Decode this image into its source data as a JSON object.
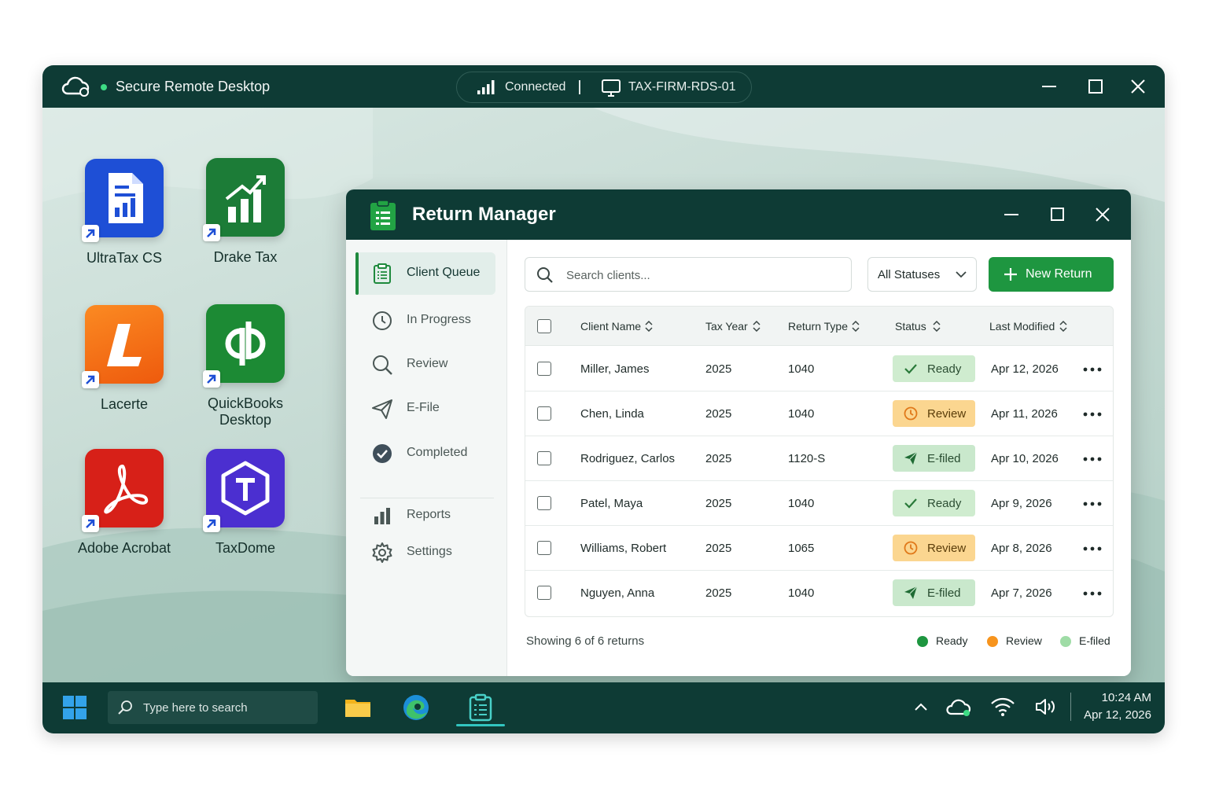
{
  "remote_desktop": {
    "title": "Secure Remote Desktop",
    "connection_status": "Connected",
    "host_name": "TAX-FIRM-RDS-01",
    "status_color": "#3ddc84"
  },
  "desktop_icons": [
    {
      "label": "UltraTax CS",
      "icon": "document-chart-icon",
      "color": "#1e4fd6"
    },
    {
      "label": "Drake Tax",
      "icon": "rising-chart-icon",
      "color": "#1c7c37"
    },
    {
      "label": "Lacerte",
      "icon": "letter-l-icon",
      "color": "#f26b12"
    },
    {
      "label": "QuickBooks Desktop",
      "icon": "quickbooks-icon",
      "color": "#1c8a34"
    },
    {
      "label": "Adobe Acrobat",
      "icon": "acrobat-icon",
      "color": "#d72018"
    },
    {
      "label": "TaxDome",
      "icon": "taxdome-icon",
      "color": "#4b2fd0"
    }
  ],
  "return_manager": {
    "title": "Return Manager",
    "nav": [
      {
        "label": "Client Queue",
        "icon": "clipboard-icon",
        "active": true
      },
      {
        "label": "In Progress",
        "icon": "clock-icon",
        "active": false
      },
      {
        "label": "Review",
        "icon": "magnifier-icon",
        "active": false
      },
      {
        "label": "E-File",
        "icon": "paper-plane-icon",
        "active": false
      },
      {
        "label": "Completed",
        "icon": "check-circle-icon",
        "active": false
      },
      {
        "label": "Reports",
        "icon": "bar-chart-icon",
        "active": false
      },
      {
        "label": "Settings",
        "icon": "gear-icon",
        "active": false
      }
    ],
    "search": {
      "placeholder": "Search clients..."
    },
    "status_filter": {
      "selected": "All Statuses"
    },
    "new_return_label": "New Return",
    "table": {
      "columns": [
        "Client Name",
        "Tax Year",
        "Return Type",
        "Status",
        "Last Modified"
      ],
      "rows": [
        {
          "client": "Miller, James",
          "year": "2025",
          "type": "1040",
          "status": "Ready",
          "modified": "Apr 12, 2026"
        },
        {
          "client": "Chen, Linda",
          "year": "2025",
          "type": "1040",
          "status": "Review",
          "modified": "Apr 11, 2026"
        },
        {
          "client": "Rodriguez, Carlos",
          "year": "2025",
          "type": "1120-S",
          "status": "E-filed",
          "modified": "Apr 10, 2026"
        },
        {
          "client": "Patel, Maya",
          "year": "2025",
          "type": "1040",
          "status": "Ready",
          "modified": "Apr 9, 2026"
        },
        {
          "client": "Williams, Robert",
          "year": "2025",
          "type": "1065",
          "status": "Review",
          "modified": "Apr 8, 2026"
        },
        {
          "client": "Nguyen, Anna",
          "year": "2025",
          "type": "1040",
          "status": "E-filed",
          "modified": "Apr 7, 2026"
        }
      ]
    },
    "footer_text": "Showing 6 of 6 returns",
    "legend": [
      {
        "label": "Ready",
        "color": "#1e9640"
      },
      {
        "label": "Review",
        "color": "#f7941d"
      },
      {
        "label": "E-filed",
        "color": "#9fdca6"
      }
    ]
  },
  "taskbar": {
    "search_placeholder": "Type here to search",
    "apps": [
      "folder-icon",
      "edge-browser-icon",
      "return-manager-icon"
    ],
    "time": "10:24 AM",
    "date": "Apr 12, 2026"
  },
  "colors": {
    "title_bar": "#0e3b35",
    "accent_green": "#1e9640"
  }
}
